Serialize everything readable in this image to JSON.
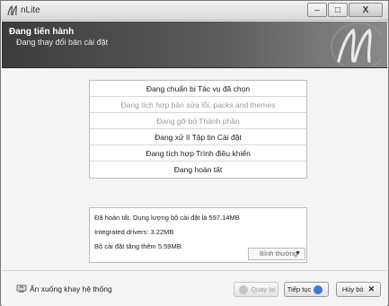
{
  "window": {
    "title": "nLite",
    "minimize_glyph": "–",
    "maximize_glyph": "□",
    "close_glyph": "X"
  },
  "header": {
    "title": "Đang tiến hành",
    "subtitle": "Đang thay đổi bản cài đặt",
    "logo_icon": "nlite-logo-icon"
  },
  "tasks": [
    {
      "label": "Đang chuẩn bị Tác vụ đã chọn",
      "state": "active"
    },
    {
      "label": "Đang tích hợp bản sửa lỗi, packs and themes",
      "state": "dim"
    },
    {
      "label": "Đang gỡ bỏ Thành phần",
      "state": "dim"
    },
    {
      "label": "Đang xử lí Tập tin Cài đặt",
      "state": "active"
    },
    {
      "label": "Đang tích hợp Trình điều khiển",
      "state": "active"
    },
    {
      "label": "Đang hoàn tất",
      "state": "active"
    }
  ],
  "log": {
    "lines": [
      "Đã hoàn tất. Dung lượng bộ cài đặt là 597.14MB",
      "Integrated drivers: 3.22MB",
      "Bộ cài đặt tăng thêm 5.59MB."
    ],
    "priority_value": "Bình thường"
  },
  "footer": {
    "tray_label": "Ẩn xuống khay hệ thống",
    "back_label": "Quay lại",
    "next_label": "Tiếp tục",
    "cancel_label": "Hủy bỏ",
    "cancel_glyph": "✕"
  },
  "colors": {
    "banner_dark": "#3c3c3c",
    "next_icon": "#3a7bd5",
    "back_icon": "#bdbdbd"
  }
}
